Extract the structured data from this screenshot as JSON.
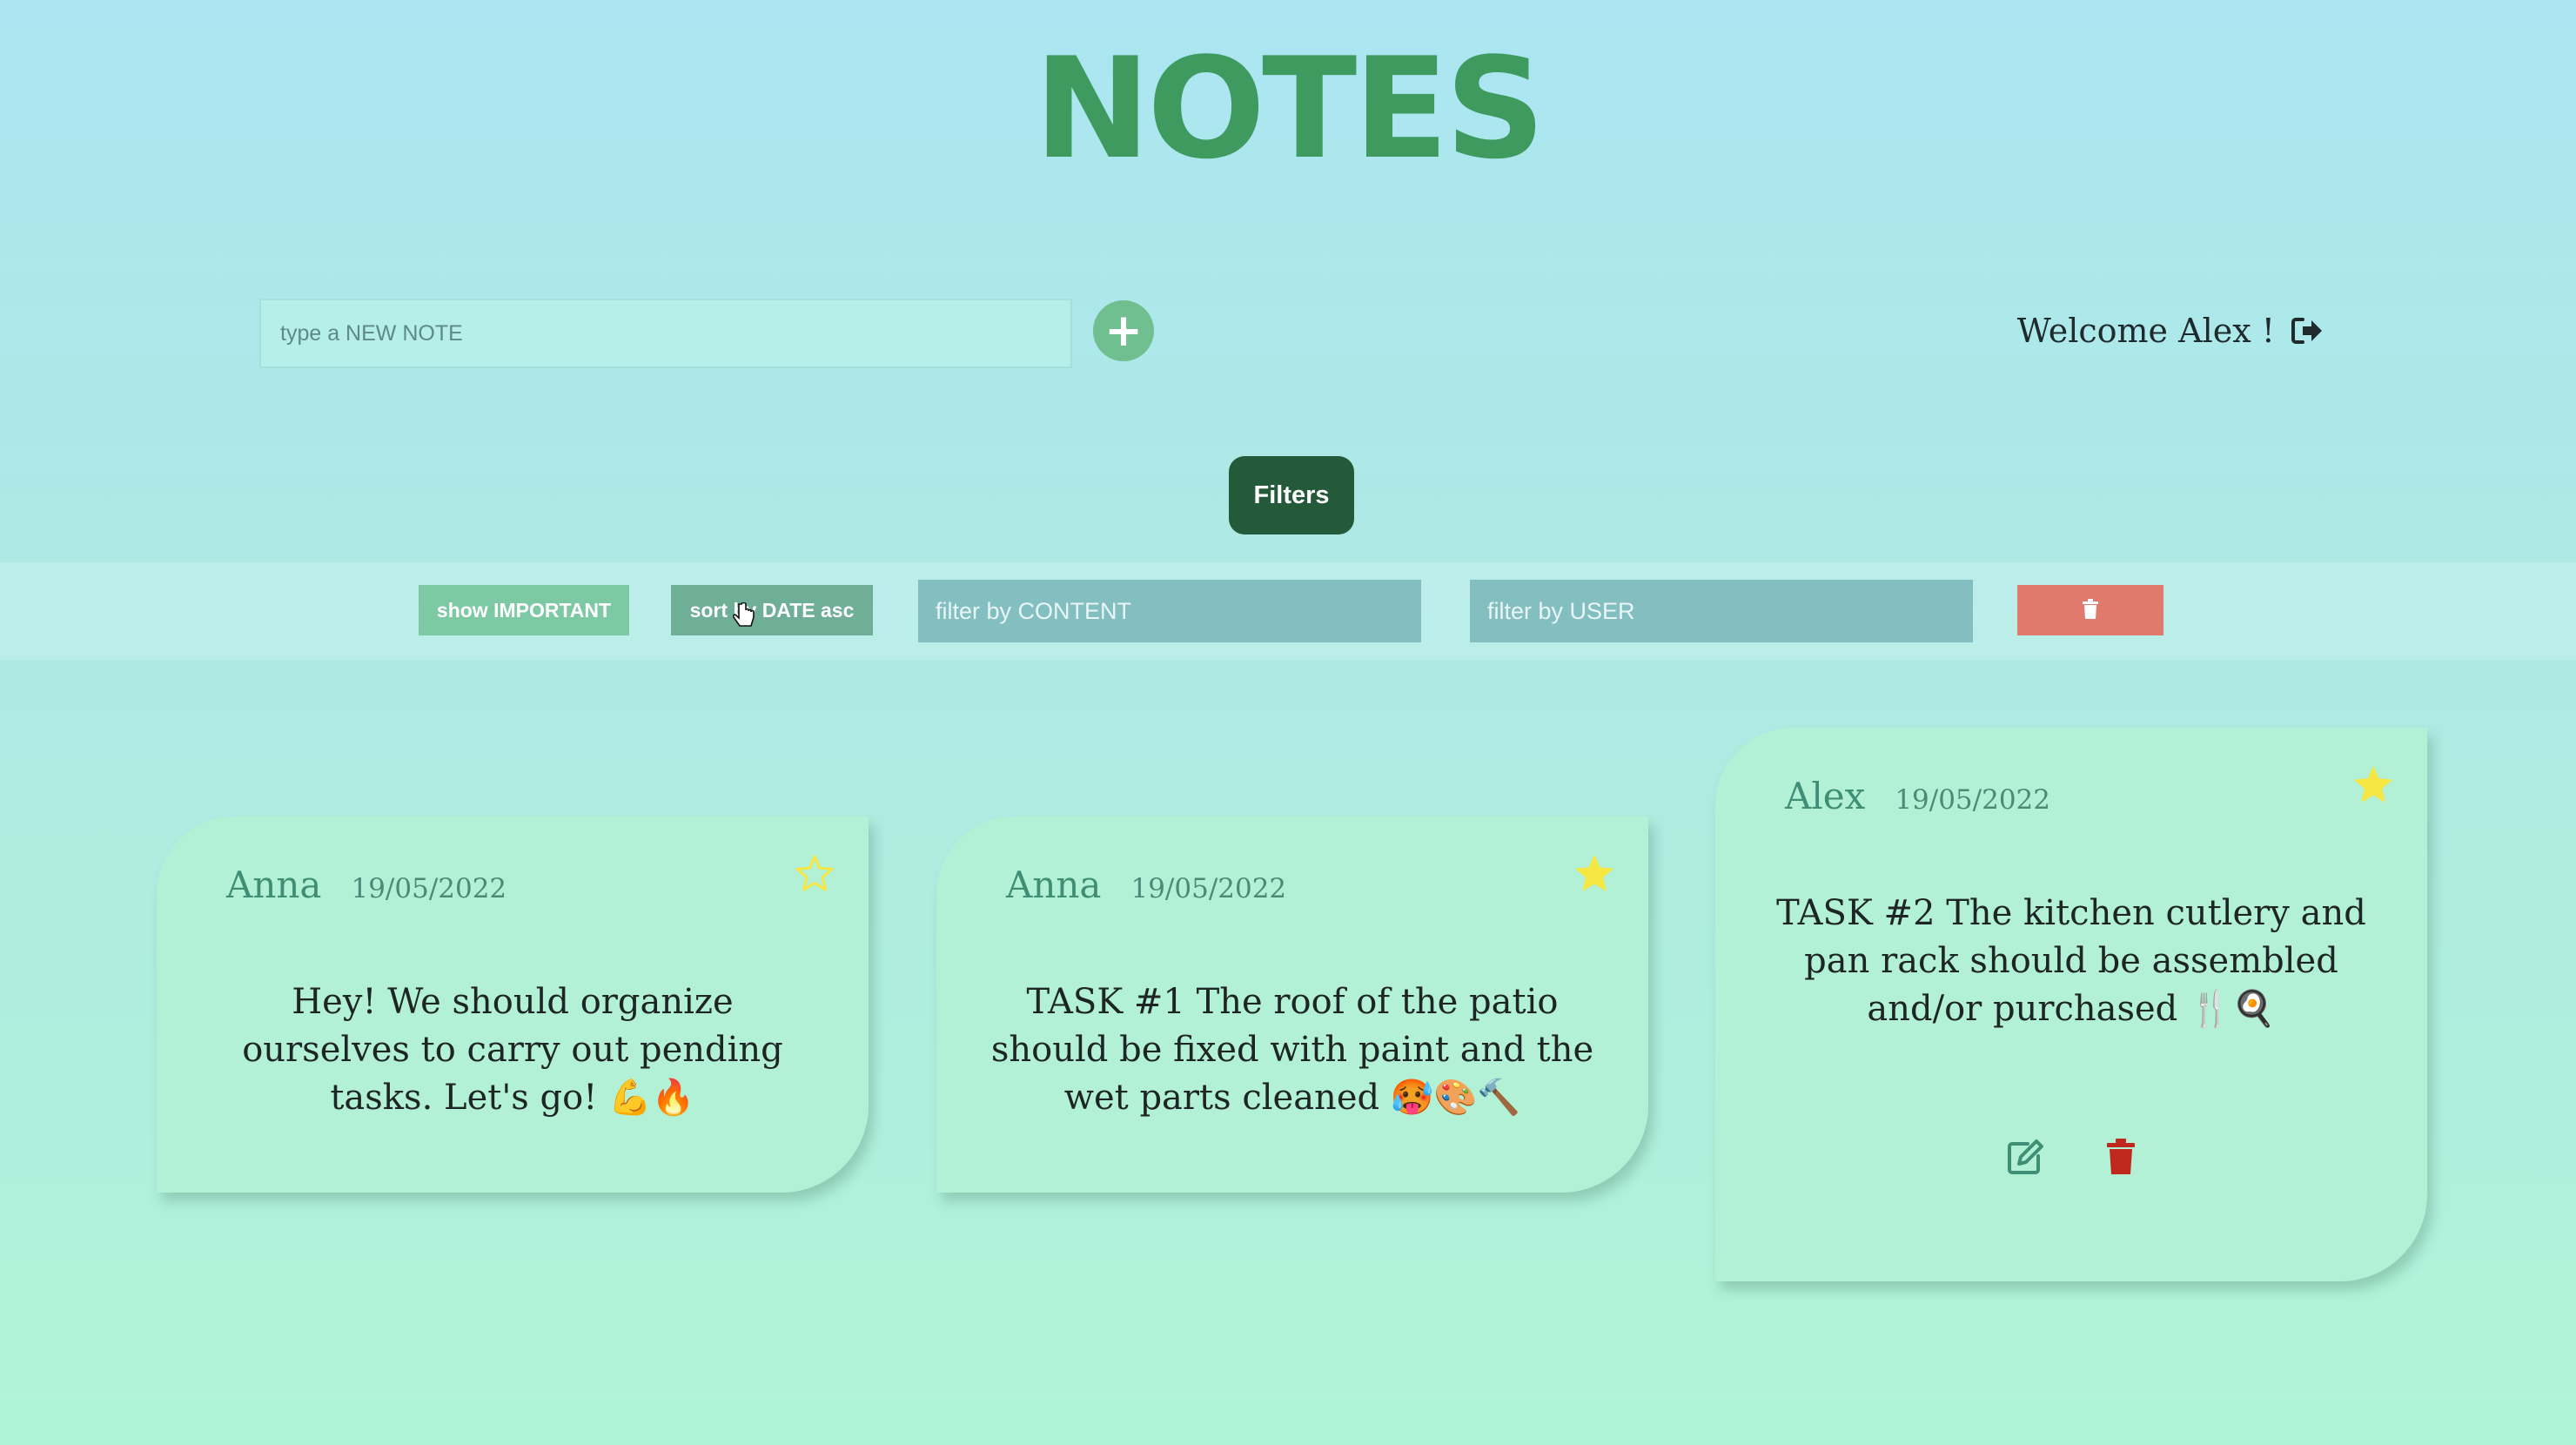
{
  "app": {
    "title": "NOTES"
  },
  "new_note": {
    "placeholder": "type a NEW NOTE",
    "add_symbol": "+"
  },
  "header": {
    "welcome": "Welcome Alex !"
  },
  "filters": {
    "toggle_label": "Filters",
    "show_important": "show IMPORTANT",
    "sort_label": "sort by DATE asc",
    "content_placeholder": "filter by CONTENT",
    "user_placeholder": "filter by USER"
  },
  "notes": [
    {
      "user": "Anna",
      "date": "19/05/2022",
      "important": false,
      "text": "Hey! We should organize ourselves to carry out pending tasks. Let's go! 💪🔥"
    },
    {
      "user": "Anna",
      "date": "19/05/2022",
      "important": true,
      "text": "TASK #1 The roof of the patio should be fixed with paint and the wet parts cleaned 🥵🎨🔨"
    },
    {
      "user": "Alex",
      "date": "19/05/2022",
      "important": true,
      "text": "TASK #2 The kitchen cutlery and pan rack should be assembled and/or purchased 🍴🍳"
    }
  ],
  "colors": {
    "title": "#3e9a5f",
    "star": "#f5e642",
    "delete": "#c0281e",
    "filters_button": "#245a3a"
  },
  "icons": {
    "star": "star-icon",
    "edit": "edit-icon",
    "trash": "trash-icon",
    "logout": "logout-icon"
  }
}
